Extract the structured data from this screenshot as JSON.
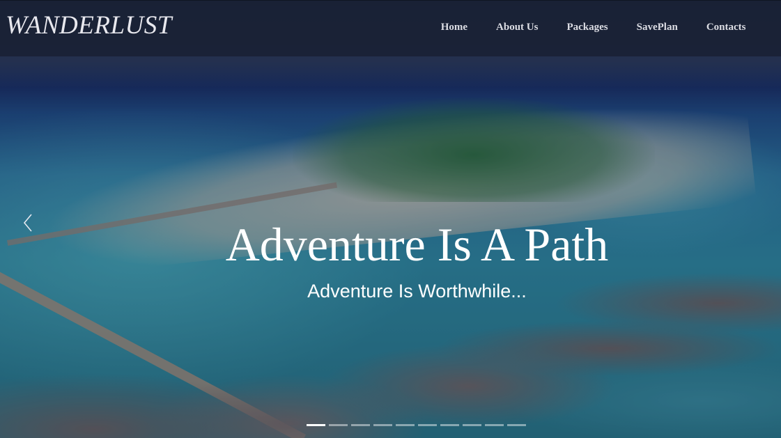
{
  "brand": "WANDERLUST",
  "nav": {
    "items": [
      "Home",
      "About Us",
      "Packages",
      "SavePlan",
      "Contacts"
    ]
  },
  "carousel": {
    "title": "Adventure Is A Path",
    "subtitle": "Adventure Is Worthwhile...",
    "prev_icon": "chevron-left-icon",
    "indicators": 10,
    "active_index": 0
  },
  "colors": {
    "navbar_bg": "#192032",
    "text": "#ffffff"
  }
}
